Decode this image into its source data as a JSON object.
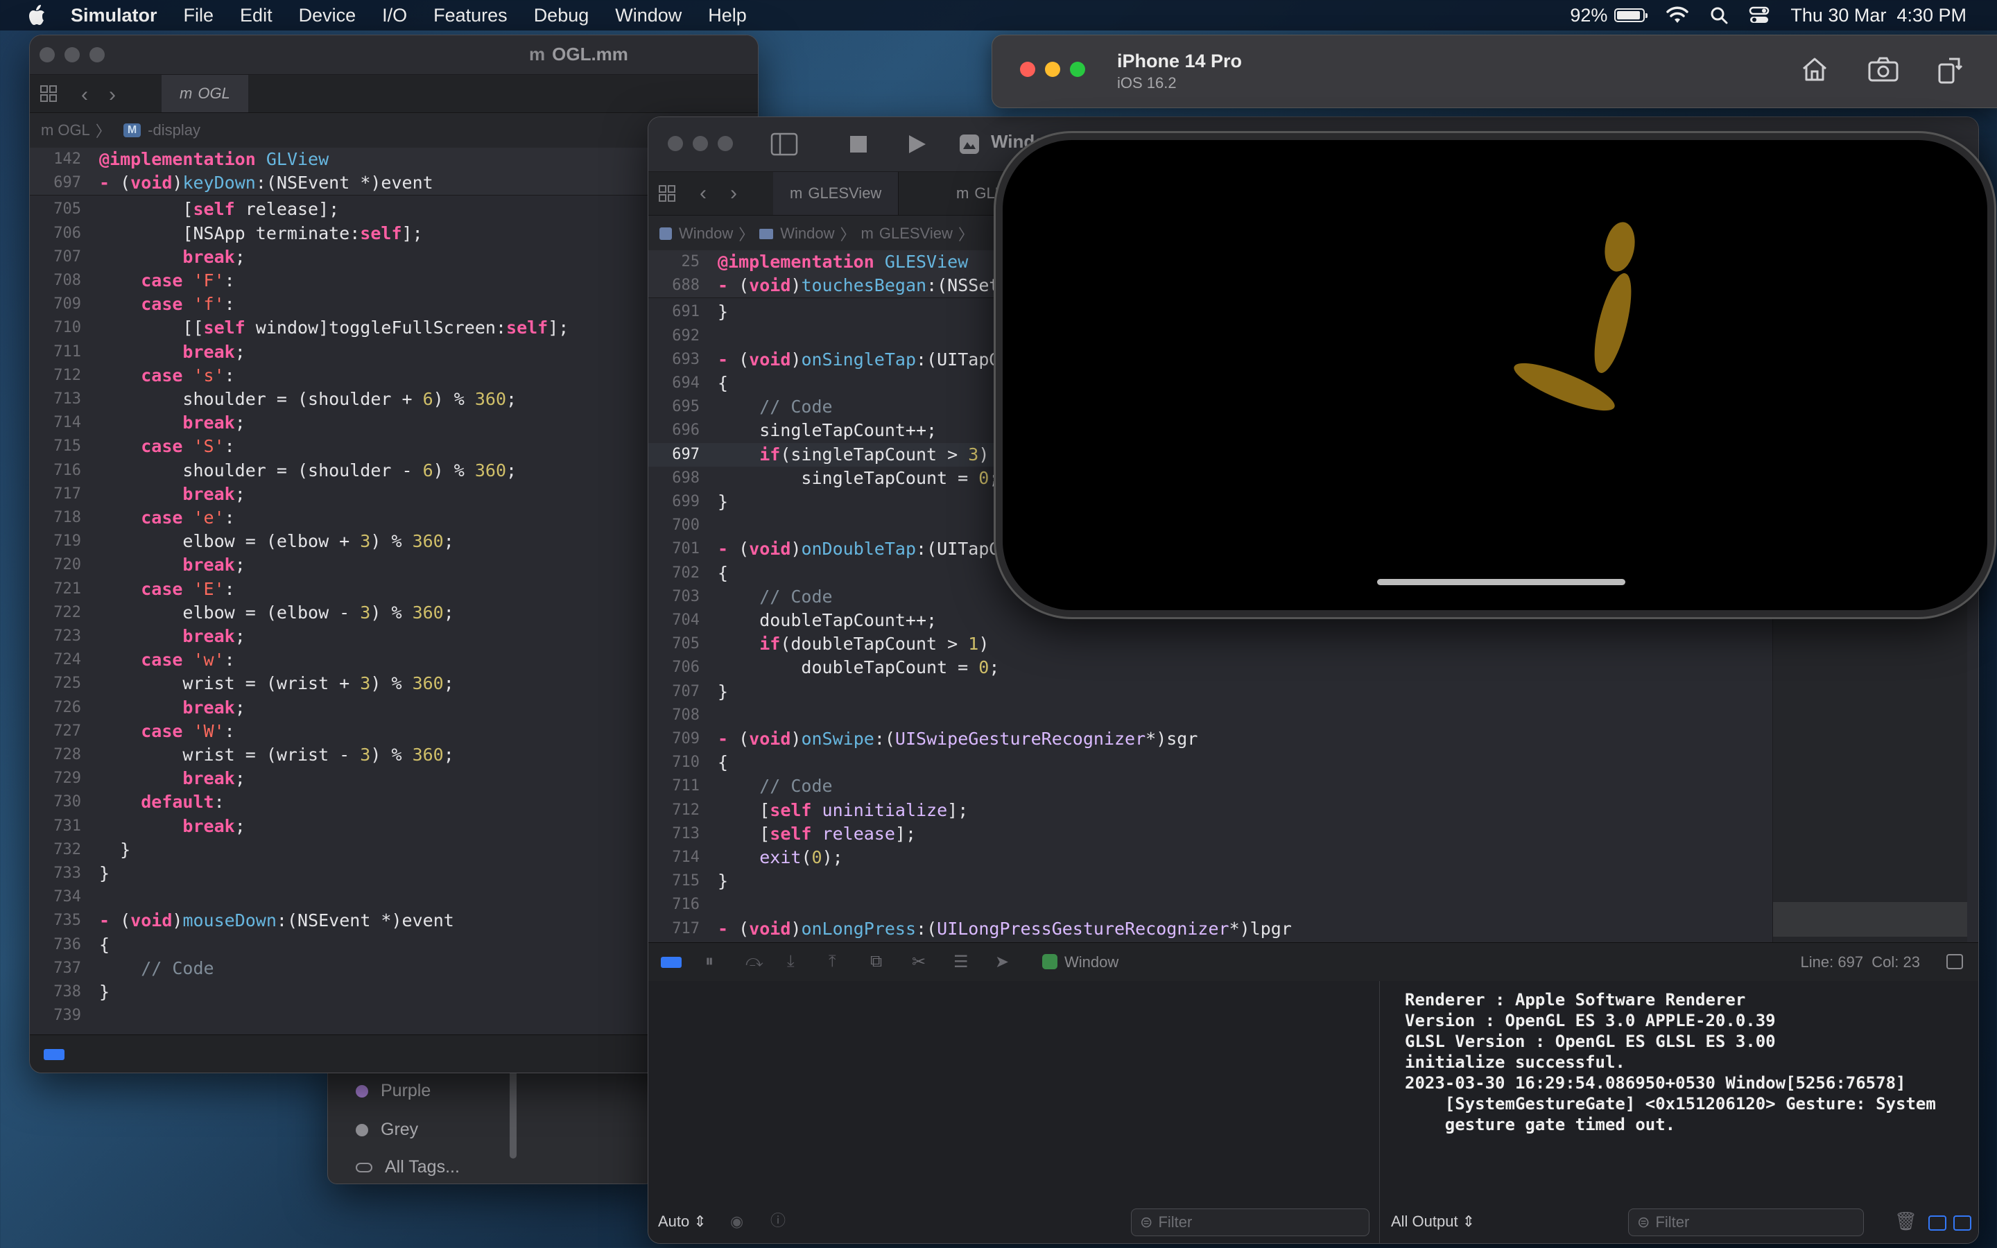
{
  "menubar": {
    "app": "Simulator",
    "items": [
      "File",
      "Edit",
      "Device",
      "I/O",
      "Features",
      "Debug",
      "Window",
      "Help"
    ],
    "battery": "92%",
    "battery_level": 0.92,
    "datetime": "Thu 30 Mar  4:30 PM"
  },
  "left_window": {
    "title": "OGL.mm",
    "tab": "OGL",
    "breadcrumb": [
      "OGL",
      "-display"
    ],
    "breadcrumb_badge": "M",
    "sticky": [
      {
        "ln": "142",
        "html": "<span class='kw'>@implementation</span> <span class='fn'>GLView</span>"
      },
      {
        "ln": "697",
        "html": "<span class='kw'>-</span> (<span class='kw'>void</span>)<span class='fn'>keyDown</span>:(NSEvent *)event"
      }
    ],
    "lines": [
      {
        "ln": "705",
        "html": "        [<span class='kw'>self</span> release];"
      },
      {
        "ln": "706",
        "html": "        [NSApp terminate:<span class='kw'>self</span>];"
      },
      {
        "ln": "707",
        "html": "        <span class='kw'>break</span>;"
      },
      {
        "ln": "708",
        "html": "    <span class='kw'>case</span> <span class='str'>'F'</span>:"
      },
      {
        "ln": "709",
        "html": "    <span class='kw'>case</span> <span class='str'>'f'</span>:"
      },
      {
        "ln": "710",
        "html": "        [[<span class='kw'>self</span> window]toggleFullScreen:<span class='kw'>self</span>];"
      },
      {
        "ln": "711",
        "html": "        <span class='kw'>break</span>;"
      },
      {
        "ln": "712",
        "html": "    <span class='kw'>case</span> <span class='str'>'s'</span>:"
      },
      {
        "ln": "713",
        "html": "        shoulder = (shoulder + <span class='num'>6</span>) % <span class='num'>360</span>;"
      },
      {
        "ln": "714",
        "html": "        <span class='kw'>break</span>;"
      },
      {
        "ln": "715",
        "html": "    <span class='kw'>case</span> <span class='str'>'S'</span>:"
      },
      {
        "ln": "716",
        "html": "        shoulder = (shoulder - <span class='num'>6</span>) % <span class='num'>360</span>;"
      },
      {
        "ln": "717",
        "html": "        <span class='kw'>break</span>;"
      },
      {
        "ln": "718",
        "html": "    <span class='kw'>case</span> <span class='str'>'e'</span>:"
      },
      {
        "ln": "719",
        "html": "        elbow = (elbow + <span class='num'>3</span>) % <span class='num'>360</span>;"
      },
      {
        "ln": "720",
        "html": "        <span class='kw'>break</span>;"
      },
      {
        "ln": "721",
        "html": "    <span class='kw'>case</span> <span class='str'>'E'</span>:"
      },
      {
        "ln": "722",
        "html": "        elbow = (elbow - <span class='num'>3</span>) % <span class='num'>360</span>;"
      },
      {
        "ln": "723",
        "html": "        <span class='kw'>break</span>;"
      },
      {
        "ln": "724",
        "html": "    <span class='kw'>case</span> <span class='str'>'w'</span>:"
      },
      {
        "ln": "725",
        "html": "        wrist = (wrist + <span class='num'>3</span>) % <span class='num'>360</span>;"
      },
      {
        "ln": "726",
        "html": "        <span class='kw'>break</span>;"
      },
      {
        "ln": "727",
        "html": "    <span class='kw'>case</span> <span class='str'>'W'</span>:"
      },
      {
        "ln": "728",
        "html": "        wrist = (wrist - <span class='num'>3</span>) % <span class='num'>360</span>;"
      },
      {
        "ln": "729",
        "html": "        <span class='kw'>break</span>;"
      },
      {
        "ln": "730",
        "html": "    <span class='kw'>default</span>:"
      },
      {
        "ln": "731",
        "html": "        <span class='kw'>break</span>;"
      },
      {
        "ln": "732",
        "html": "  }"
      },
      {
        "ln": "733",
        "html": "}"
      },
      {
        "ln": "734",
        "html": ""
      },
      {
        "ln": "735",
        "html": "<span class='kw'>-</span> (<span class='kw'>void</span>)<span class='fn'>mouseDown</span>:(NSEvent *)event"
      },
      {
        "ln": "736",
        "html": "{"
      },
      {
        "ln": "737",
        "html": "    <span class='cmt'>// Code</span>"
      },
      {
        "ln": "738",
        "html": "}"
      },
      {
        "ln": "739",
        "html": ""
      }
    ]
  },
  "tags": [
    {
      "label": "Purple",
      "color": "#a07acb"
    },
    {
      "label": "Grey",
      "color": "#8e8e93"
    },
    {
      "label": "All Tags...",
      "color": ""
    }
  ],
  "mid_window": {
    "title": "Window",
    "tabs": [
      "GLESView",
      "GLE"
    ],
    "breadcrumb": [
      "Window",
      "Window",
      "GLESView"
    ],
    "sticky": [
      {
        "ln": "25",
        "html": "<span class='kw'>@implementation</span> <span class='fn'>GLESView</span>"
      },
      {
        "ln": "688",
        "html": "<span class='kw'>-</span> (<span class='kw'>void</span>)<span class='fn'>touchesBegan</span>:(NSSet"
      }
    ],
    "lines": [
      {
        "ln": "691",
        "html": "}"
      },
      {
        "ln": "692",
        "html": ""
      },
      {
        "ln": "693",
        "html": "<span class='kw'>-</span> (<span class='kw'>void</span>)<span class='fn'>onSingleTap</span>:(UITapG"
      },
      {
        "ln": "694",
        "html": "{"
      },
      {
        "ln": "695",
        "html": "    <span class='cmt'>// Code</span>"
      },
      {
        "ln": "696",
        "html": "    singleTapCount++;"
      },
      {
        "ln": "697",
        "html": "    <span class='kw'>if</span>(singleTapCount &gt; <span class='num'>3</span>)",
        "active": true
      },
      {
        "ln": "698",
        "html": "        singleTapCount = <span class='num'>0</span>;"
      },
      {
        "ln": "699",
        "html": "}"
      },
      {
        "ln": "700",
        "html": ""
      },
      {
        "ln": "701",
        "html": "<span class='kw'>-</span> (<span class='kw'>void</span>)<span class='fn'>onDoubleTap</span>:(UITapG"
      },
      {
        "ln": "702",
        "html": "{"
      },
      {
        "ln": "703",
        "html": "    <span class='cmt'>// Code</span>"
      },
      {
        "ln": "704",
        "html": "    doubleTapCount++;"
      },
      {
        "ln": "705",
        "html": "    <span class='kw'>if</span>(doubleTapCount &gt; <span class='num'>1</span>)"
      },
      {
        "ln": "706",
        "html": "        doubleTapCount = <span class='num'>0</span>;"
      },
      {
        "ln": "707",
        "html": "}"
      },
      {
        "ln": "708",
        "html": ""
      },
      {
        "ln": "709",
        "html": "<span class='kw'>-</span> (<span class='kw'>void</span>)<span class='fn'>onSwipe</span>:(<span class='ty'>UISwipeGestureRecognizer</span>*)sgr"
      },
      {
        "ln": "710",
        "html": "{"
      },
      {
        "ln": "711",
        "html": "    <span class='cmt'>// Code</span>"
      },
      {
        "ln": "712",
        "html": "    [<span class='kw'>self</span> <span class='ty'>uninitialize</span>];"
      },
      {
        "ln": "713",
        "html": "    [<span class='kw'>self</span> <span class='ty'>release</span>];"
      },
      {
        "ln": "714",
        "html": "    <span class='ty'>exit</span>(<span class='num'>0</span>);"
      },
      {
        "ln": "715",
        "html": "}"
      },
      {
        "ln": "716",
        "html": ""
      },
      {
        "ln": "717",
        "html": "<span class='kw'>-</span> (<span class='kw'>void</span>)<span class='fn'>onLongPress</span>:(<span class='ty'>UILongPressGestureRecognizer</span>*)lpgr"
      }
    ],
    "debug_target": "Window",
    "cursor": "Line: 697  Col: 23",
    "auto_label": "Auto",
    "filter_placeholder": "Filter",
    "output_selector": "All Output",
    "console": "Renderer : Apple Software Renderer\nVersion : OpenGL ES 3.0 APPLE-20.0.39\nGLSL Version : OpenGL ES GLSL ES 3.00\ninitialize successful.\n2023-03-30 16:29:54.086950+0530 Window[5256:76578]\n    [SystemGestureGate] <0x151206120> Gesture: System\n    gesture gate timed out."
  },
  "simulator": {
    "device": "iPhone 14 Pro",
    "os": "iOS 16.2",
    "render_color": "#8b6914"
  }
}
